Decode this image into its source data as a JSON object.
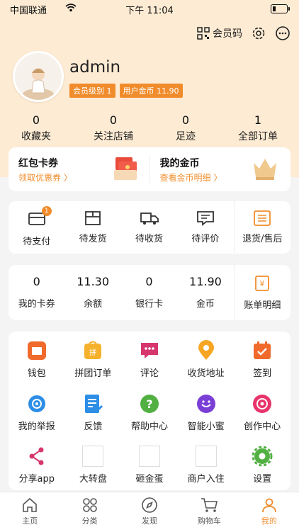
{
  "status_bar": {
    "carrier": "中国联通",
    "time": "下午 11:04"
  },
  "header": {
    "member_code": "会员码"
  },
  "profile": {
    "name": "admin",
    "level_badge": "会员级别 1",
    "coins_badge": "用户金币 11.90"
  },
  "stats": [
    {
      "value": "0",
      "label": "收藏夹"
    },
    {
      "value": "0",
      "label": "关注店铺"
    },
    {
      "value": "0",
      "label": "足迹"
    },
    {
      "value": "1",
      "label": "全部订单"
    }
  ],
  "coupon_card": {
    "left_title": "红包卡券",
    "left_link": "领取优惠券 〉",
    "right_title": "我的金币",
    "right_link": "查看金币明细 〉"
  },
  "orders": [
    {
      "label": "待支付",
      "badge": "1"
    },
    {
      "label": "待发货"
    },
    {
      "label": "待收货"
    },
    {
      "label": "待评价"
    },
    {
      "label": "退货/售后"
    }
  ],
  "assets": [
    {
      "value": "0",
      "label": "我的卡券"
    },
    {
      "value": "11.30",
      "label": "余额"
    },
    {
      "value": "0",
      "label": "银行卡"
    },
    {
      "value": "11.90",
      "label": "金币"
    },
    {
      "label": "账单明细"
    }
  ],
  "tools": [
    {
      "label": "钱包",
      "icon": "wallet-icon"
    },
    {
      "label": "拼团订单",
      "icon": "group-order-icon"
    },
    {
      "label": "评论",
      "icon": "comment-icon"
    },
    {
      "label": "收货地址",
      "icon": "location-icon"
    },
    {
      "label": "签到",
      "icon": "calendar-icon"
    },
    {
      "label": "我的举报",
      "icon": "report-icon"
    },
    {
      "label": "反馈",
      "icon": "feedback-icon"
    },
    {
      "label": "帮助中心",
      "icon": "help-icon"
    },
    {
      "label": "智能小蜜",
      "icon": "assistant-icon"
    },
    {
      "label": "创作中心",
      "icon": "creation-icon"
    },
    {
      "label": "分享app",
      "icon": "share-icon"
    },
    {
      "label": "大转盘",
      "icon": "placeholder-icon"
    },
    {
      "label": "砸金蛋",
      "icon": "placeholder-icon"
    },
    {
      "label": "商户入住",
      "icon": "placeholder-icon"
    },
    {
      "label": "设置",
      "icon": "settings-icon"
    }
  ],
  "tabbar": [
    {
      "label": "主页"
    },
    {
      "label": "分类"
    },
    {
      "label": "发现"
    },
    {
      "label": "购物车"
    },
    {
      "label": "我的"
    }
  ],
  "colors": {
    "accent": "#f08c2b",
    "hero_bg": "#fdebd3",
    "page_bg": "#f4f4f4"
  }
}
